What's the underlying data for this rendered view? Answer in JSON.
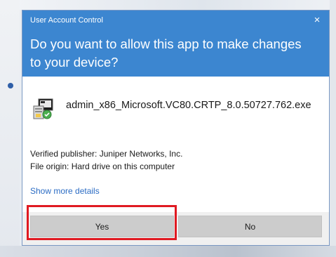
{
  "dialog": {
    "window_title": "User Account Control",
    "close_glyph": "×",
    "question": "Do you want to allow this app to make changes to your device?",
    "header_color": "#3c86d0",
    "file_icon": "installer-app-icon",
    "file_name": "admin_x86_Microsoft.VC80.CRTP_8.0.50727.762.exe",
    "verified_publisher": "Verified publisher: Juniper Networks, Inc.",
    "file_origin": "File origin: Hard drive on this computer",
    "details_link": "Show more details",
    "buttons": {
      "yes_label": "Yes",
      "no_label": "No"
    }
  },
  "annotation": {
    "highlight_color": "#e01a22",
    "highlighted_target": "Yes"
  }
}
